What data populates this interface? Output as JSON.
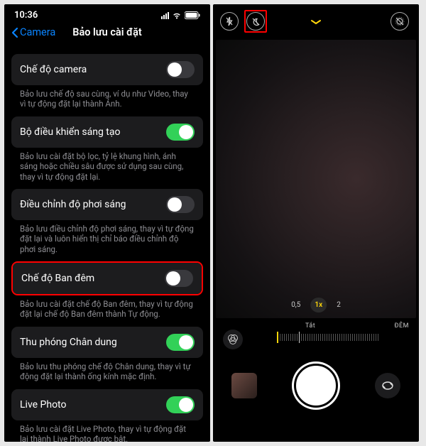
{
  "settings": {
    "statusbar_time": "10:36",
    "back_label": "Camera",
    "title": "Bảo lưu cài đặt",
    "items": [
      {
        "label": "Chế độ camera",
        "description": "Bảo lưu chế độ sau cùng, ví dụ như Video, thay vì tự động đặt lại thành Ảnh.",
        "on": false,
        "highlighted": false
      },
      {
        "label": "Bộ điều khiển sáng tạo",
        "description": "Bảo lưu cài đặt bộ lọc, tỷ lệ khung hình, ánh sáng hoặc chiều sâu được sử dụng sau cùng, thay vì tự động đặt lại.",
        "on": true,
        "highlighted": false
      },
      {
        "label": "Điều chỉnh độ phơi sáng",
        "description": "Bảo lưu điều chỉnh độ phơi sáng, thay vì tự động đặt lại và luôn hiển thị chỉ báo điều chỉnh độ phơi sáng.",
        "on": false,
        "highlighted": false
      },
      {
        "label": "Chế độ Ban đêm",
        "description": "Bảo lưu cài đặt chế độ Ban đêm, thay vì tự động đặt lại chế độ Ban đêm thành Tự động.",
        "on": false,
        "highlighted": true
      },
      {
        "label": "Thu phóng Chân dung",
        "description": "Bảo lưu thu phóng chế độ Chân dung, thay vì tự động đặt lại thành ống kính mặc định.",
        "on": true,
        "highlighted": false
      },
      {
        "label": "Live Photo",
        "description": "Bảo lưu cài đặt Live Photo, thay vì tự động đặt lại thành Live Photo được bật.",
        "on": true,
        "highlighted": false
      }
    ]
  },
  "camera": {
    "zoom_options": [
      "0,5",
      "1x",
      "2"
    ],
    "zoom_active_index": 1,
    "slider_label_center": "Tắt",
    "slider_label_right": "ĐÊM"
  }
}
